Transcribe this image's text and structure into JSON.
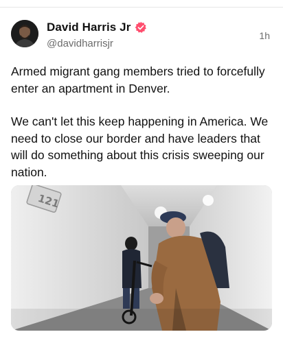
{
  "post": {
    "author": {
      "display_name": "David Harris Jr",
      "handle": "@davidharrisjr",
      "avatar_icon": "profile-photo",
      "verified_icon": "verified-badge-icon",
      "verified_color": "#ff4e6e"
    },
    "time": "1h",
    "paragraphs": [
      "Armed migrant gang members tried to forcefully enter an apartment in Denver.",
      "We can't let this keep happening in America. We need to close our border and have leaders that will do something about this crisis sweeping our nation."
    ],
    "media": {
      "kind": "video-still",
      "sign_text": "121"
    }
  }
}
